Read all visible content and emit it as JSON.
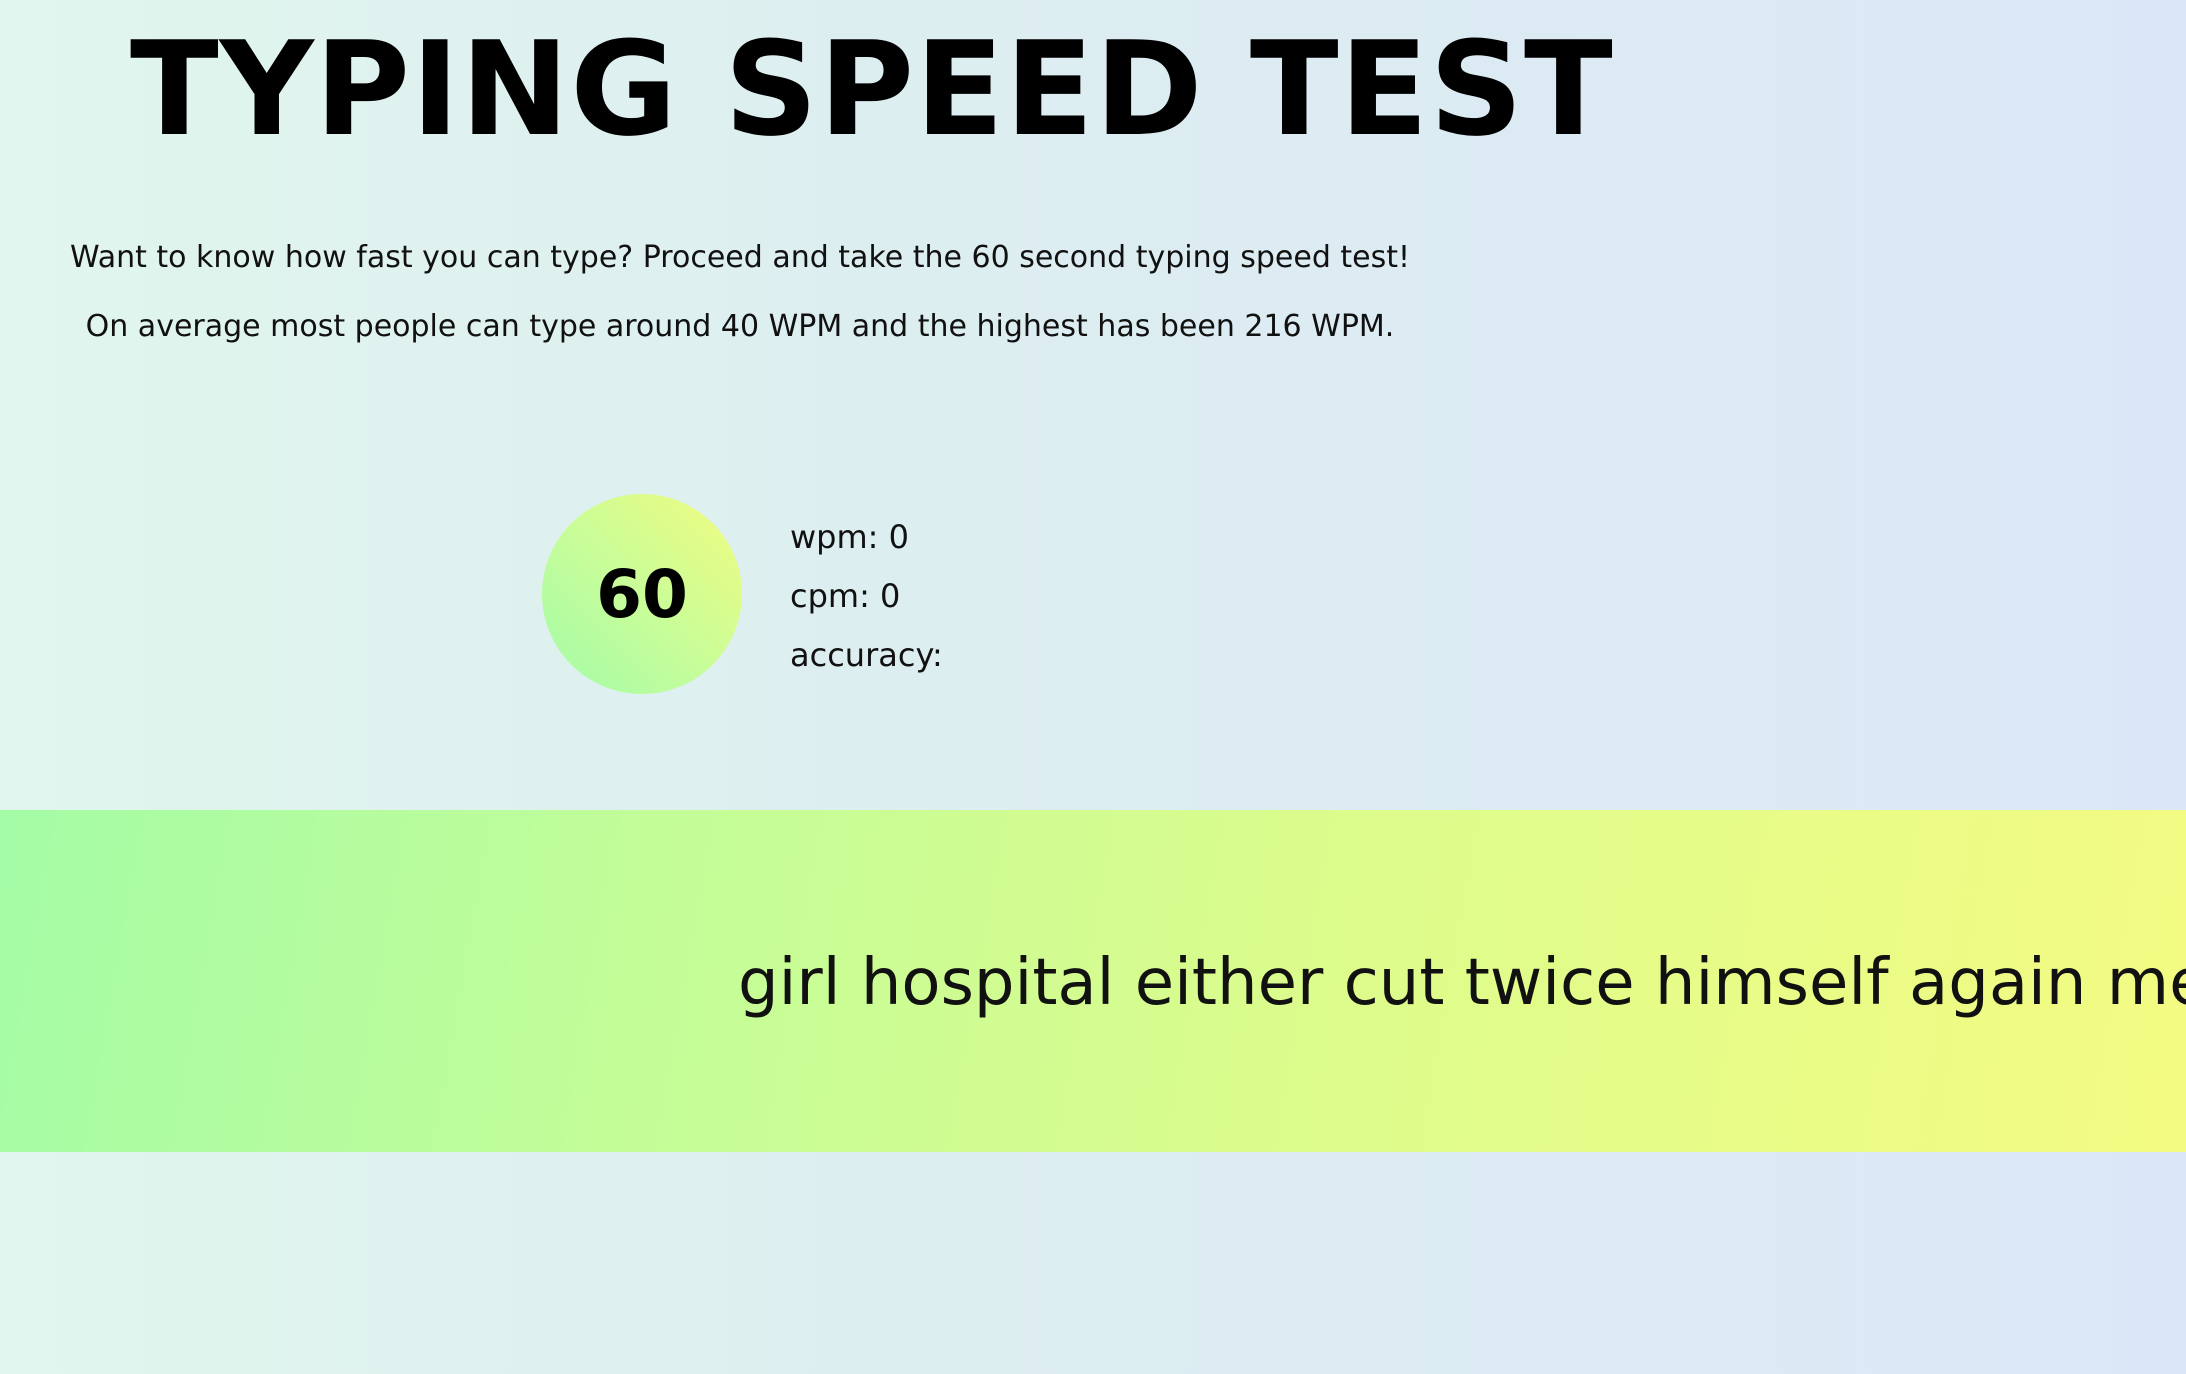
{
  "header": {
    "title": "TYPING SPEED TEST"
  },
  "intro": {
    "line1": "Want to know how fast you can type? Proceed and take the 60 second typing speed test!",
    "line2": "On average most people can type around 40 WPM and the highest has been 216 WPM."
  },
  "timer": {
    "seconds": "60"
  },
  "stats": {
    "wpm": "wpm: 0",
    "cpm": "cpm: 0",
    "accuracy": "accuracy:"
  },
  "words": {
    "text": "girl hospital either cut twice himself again me settle"
  },
  "colors": {
    "band_start": "#a4fca6",
    "band_end": "#f4fb82",
    "timer_start": "#a2fba9",
    "timer_end": "#f2fc7f",
    "page_bg_left": "#e1f6ee",
    "page_bg_right": "#dbe7f8"
  }
}
